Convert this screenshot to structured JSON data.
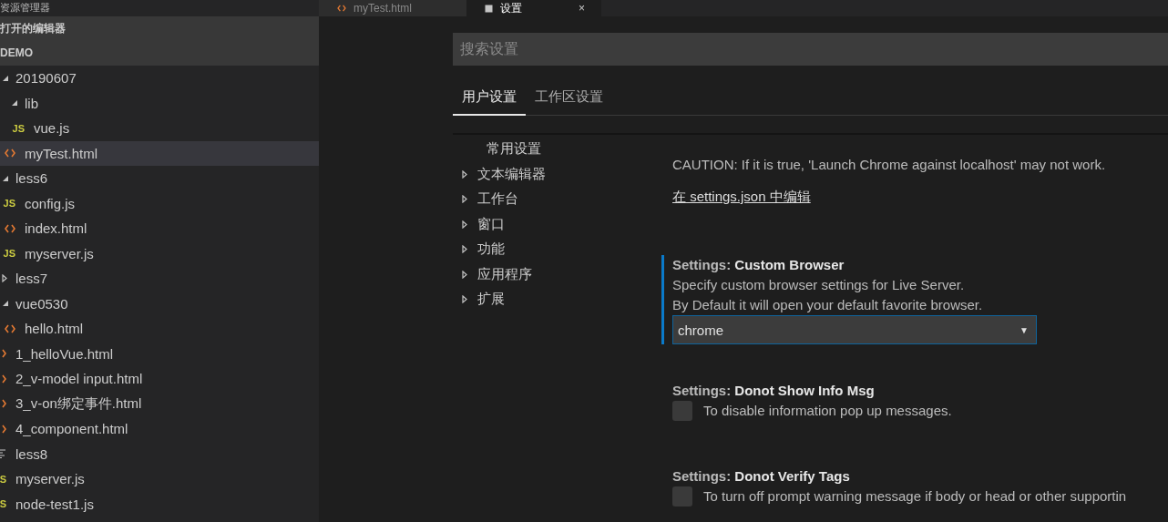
{
  "sidebar": {
    "title": "资源管理器",
    "sections": [
      {
        "label": "打开的编辑器"
      },
      {
        "label": "DEMO"
      }
    ],
    "tree": [
      {
        "label": "20190607",
        "kind": "folder",
        "expanded": true,
        "selected": false,
        "children": [
          {
            "label": "lib",
            "kind": "folder",
            "expanded": true,
            "selected": false,
            "children": [
              {
                "label": "vue.js",
                "kind": "js",
                "badge": "JS",
                "selected": false
              }
            ]
          },
          {
            "label": "myTest.html",
            "kind": "html",
            "selected": true
          }
        ]
      },
      {
        "label": "less6",
        "kind": "folder",
        "expanded": true,
        "selected": false,
        "children": [
          {
            "label": "config.js",
            "kind": "js",
            "badge": "JS",
            "selected": false
          },
          {
            "label": "index.html",
            "kind": "html",
            "selected": false
          },
          {
            "label": "myserver.js",
            "kind": "js",
            "badge": "JS",
            "selected": false
          }
        ]
      },
      {
        "label": "less7",
        "kind": "folder",
        "expanded": false,
        "selected": false
      },
      {
        "label": "vue0530",
        "kind": "folder",
        "expanded": true,
        "selected": false,
        "children": [
          {
            "label": "hello.html",
            "kind": "html",
            "selected": false
          }
        ]
      },
      {
        "label": "1_helloVue.html",
        "kind": "html",
        "selected": false
      },
      {
        "label": "2_v-model input.html",
        "kind": "html",
        "selected": false
      },
      {
        "label": "3_v-on绑定事件.html",
        "kind": "html",
        "selected": false
      },
      {
        "label": "4_component.html",
        "kind": "html",
        "selected": false
      },
      {
        "label": "less8",
        "kind": "text",
        "selected": false
      },
      {
        "label": "myserver.js",
        "kind": "js",
        "badge": "S",
        "selected": false
      },
      {
        "label": "node-test1.js",
        "kind": "js",
        "badge": "S",
        "selected": false
      }
    ]
  },
  "editor_tabs": [
    {
      "label": "myTest.html",
      "kind": "html",
      "selected": false
    },
    {
      "label": "设置",
      "kind": "settings",
      "selected": true,
      "close": "×"
    }
  ],
  "search": {
    "placeholder": "搜索设置"
  },
  "scope_tabs": [
    {
      "label": "用户设置",
      "selected": true
    },
    {
      "label": "工作区设置",
      "selected": false
    }
  ],
  "toc": [
    {
      "label": "常用设置",
      "expandable": false
    },
    {
      "label": "文本编辑器",
      "expandable": true
    },
    {
      "label": "工作台",
      "expandable": true
    },
    {
      "label": "窗口",
      "expandable": true
    },
    {
      "label": "功能",
      "expandable": true
    },
    {
      "label": "应用程序",
      "expandable": true
    },
    {
      "label": "扩展",
      "expandable": true
    }
  ],
  "settings": [
    {
      "kind": "text",
      "description": "CAUTION: If it is true, 'Launch Chrome against localhost' may not work.",
      "link": "在 settings.json 中编辑",
      "focused": false
    },
    {
      "kind": "select",
      "title": "Settings: **Custom Browser**",
      "description": "Specify custom browser settings for Live Server.\nBy Default it will open your default favorite browser.",
      "value": "chrome",
      "caret": "▼",
      "focused": true
    },
    {
      "kind": "checkbox",
      "title": "Settings: **Donot Show Info Msg**",
      "description": "To disable information pop up messages.",
      "checked": false,
      "focused": false
    },
    {
      "kind": "checkbox",
      "title": "Settings: **Donot Verify Tags**",
      "description": "To turn off prompt warning message if body or head or other supportin",
      "checked": false,
      "focused": false
    }
  ]
}
